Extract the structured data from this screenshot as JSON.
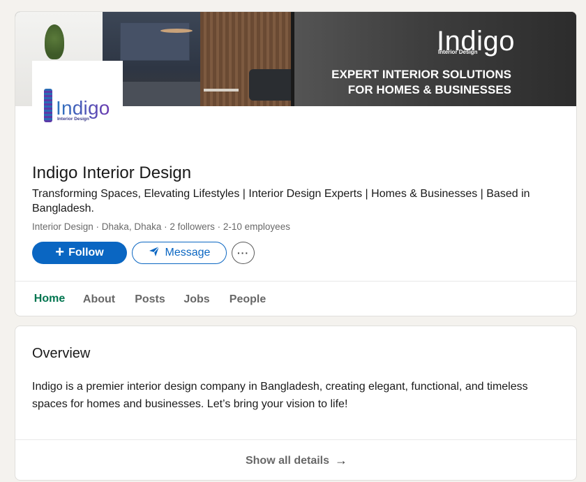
{
  "banner": {
    "logo_word": "Indigo",
    "logo_sub": "Interior Design",
    "tagline_line1": "EXPERT INTERIOR SOLUTIONS",
    "tagline_line2": "FOR HOMES & BUSINESSES"
  },
  "logo": {
    "word": "Indigo",
    "sub": "Interior Design"
  },
  "company": {
    "name": "Indigo Interior Design",
    "tagline": "Transforming Spaces, Elevating Lifestyles | Interior Design Experts | Homes & Businesses | Based in Bangladesh.",
    "industry": "Interior Design",
    "location": "Dhaka, Dhaka",
    "followers": "2 followers",
    "employees": "2-10 employees",
    "separator": " · "
  },
  "actions": {
    "follow_label": "Follow",
    "follow_icon": "+",
    "message_label": "Message",
    "more_label": "···"
  },
  "tabs": [
    {
      "label": "Home",
      "active": true
    },
    {
      "label": "About",
      "active": false
    },
    {
      "label": "Posts",
      "active": false
    },
    {
      "label": "Jobs",
      "active": false
    },
    {
      "label": "People",
      "active": false
    }
  ],
  "overview": {
    "title": "Overview",
    "text": "Indigo is a premier interior design company in Bangladesh, creating elegant, functional, and timeless spaces for homes and businesses. Let’s bring your vision to life!",
    "show_all_label": "Show all details",
    "arrow": "→"
  },
  "colors": {
    "brand_blue": "#0a66c2",
    "active_tab": "#01754f",
    "page_bg": "#f4f2ee"
  }
}
